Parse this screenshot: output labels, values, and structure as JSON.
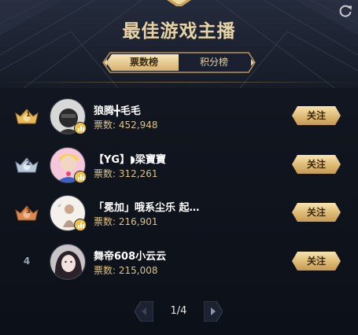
{
  "header": {
    "title": "最佳游戏主播",
    "refresh_icon": "refresh-icon"
  },
  "tabs": [
    {
      "label": "票数榜",
      "active": true
    },
    {
      "label": "积分榜",
      "active": false
    }
  ],
  "entries": [
    {
      "rank": "1",
      "name": "狼腾╋毛毛",
      "votes_label": "票数:",
      "votes": "452,948",
      "follow_label": "关注"
    },
    {
      "rank": "2",
      "name": "【YG】◗梁寶寶",
      "votes_label": "票数:",
      "votes": "312,261",
      "follow_label": "关注"
    },
    {
      "rank": "3",
      "name": "「冕加」哦系尘乐 起…",
      "votes_label": "票数:",
      "votes": "216,901",
      "follow_label": "关注"
    },
    {
      "rank": "4",
      "name": "舞帝608小云云",
      "votes_label": "票数:",
      "votes": "215,008",
      "follow_label": "关注"
    }
  ],
  "pagination": {
    "text": "1/4"
  },
  "colors": {
    "gold": "#e7d3a4",
    "rank1": "#e6b95a",
    "rank2": "#b9c6d6",
    "rank3": "#d98a52",
    "follow_button": "#dfbd78"
  }
}
